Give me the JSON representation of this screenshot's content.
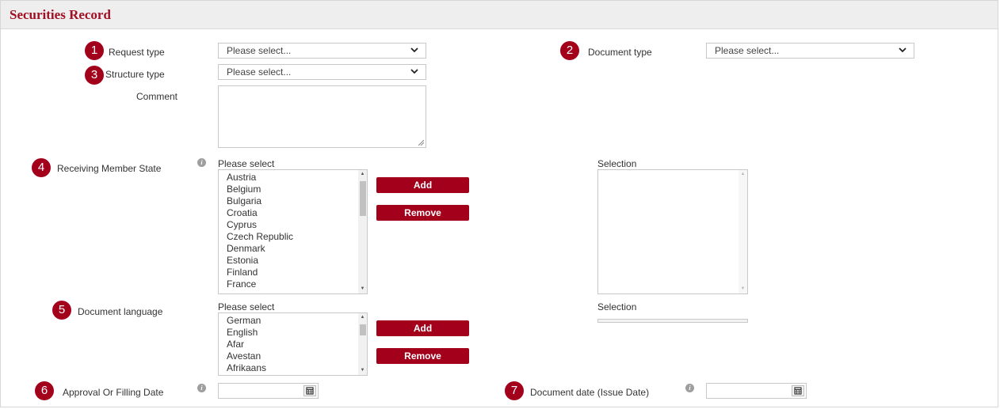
{
  "header": {
    "title": "Securities Record"
  },
  "badges": {
    "b1": "1",
    "b2": "2",
    "b3": "3",
    "b4": "4",
    "b5": "5",
    "b6": "6",
    "b7": "7"
  },
  "fields": {
    "request_type": {
      "label": "Request type",
      "value": "Please select..."
    },
    "document_type": {
      "label": "Document type",
      "value": "Please select..."
    },
    "structure_type": {
      "label": "Structure type",
      "value": "Please select..."
    },
    "comment": {
      "label": "Comment",
      "value": ""
    },
    "receiving_member_state": {
      "label": "Receiving Member State",
      "list_heading": "Please select",
      "selection_heading": "Selection",
      "options": [
        "Austria",
        "Belgium",
        "Bulgaria",
        "Croatia",
        "Cyprus",
        "Czech Republic",
        "Denmark",
        "Estonia",
        "Finland",
        "France"
      ],
      "add_label": "Add",
      "remove_label": "Remove"
    },
    "document_language": {
      "label": "Document language",
      "list_heading": "Please select",
      "selection_heading": "Selection",
      "options": [
        "German",
        "English",
        "Afar",
        "Avestan",
        "Afrikaans"
      ],
      "add_label": "Add",
      "remove_label": "Remove"
    },
    "approval_date": {
      "label": "Approval Or Filling Date",
      "value": ""
    },
    "document_date": {
      "label": "Document date (Issue Date)",
      "value": ""
    }
  },
  "colors": {
    "accent": "#a3001b",
    "title": "#a10f23",
    "header_bg": "#eeeeee"
  },
  "icons": {
    "dropdown": "chevron-down-icon",
    "info": "info-icon",
    "calendar": "calendar-icon"
  }
}
